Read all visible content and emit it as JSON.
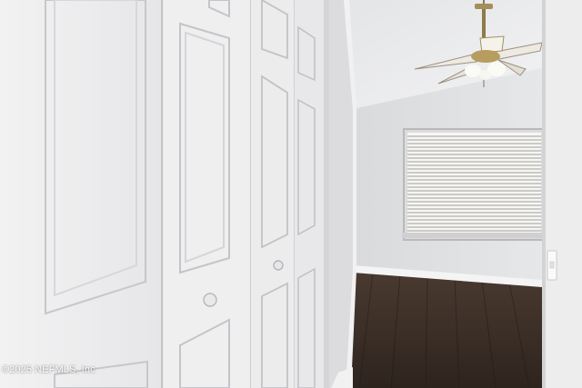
{
  "photo": {
    "watermark": "©2025 NEFMLS, Inc",
    "description_tags": [
      "closet-bifold-doors",
      "bedroom",
      "ceiling-fan",
      "window-blinds",
      "dark-wood-floor"
    ]
  }
}
